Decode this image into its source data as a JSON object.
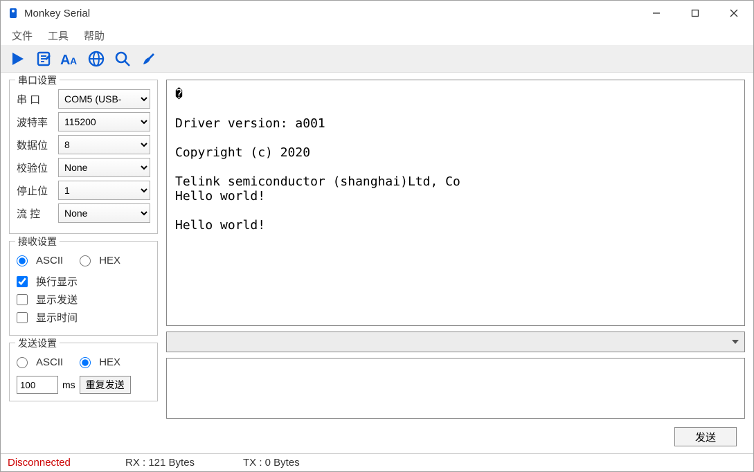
{
  "window": {
    "title": "Monkey Serial"
  },
  "menu": {
    "file": "文件",
    "tools": "工具",
    "help": "帮助"
  },
  "toolbar_icons": {
    "play": "play-icon",
    "notes": "notes-icon",
    "font": "font-icon",
    "globe": "globe-icon",
    "search": "search-icon",
    "brush": "brush-icon"
  },
  "serial_settings": {
    "legend": "串口设置",
    "port": {
      "label": "串   口",
      "value": "COM5 (USB-"
    },
    "baud": {
      "label": "波特率",
      "value": "115200"
    },
    "databits": {
      "label": "数据位",
      "value": "8"
    },
    "parity": {
      "label": "校验位",
      "value": "None"
    },
    "stopbits": {
      "label": "停止位",
      "value": "1"
    },
    "flow": {
      "label": "流   控",
      "value": "None"
    }
  },
  "recv_settings": {
    "legend": "接收设置",
    "ascii": "ASCII",
    "hex": "HEX",
    "wrap": "换行显示",
    "show_send": "显示发送",
    "show_time": "显示时间"
  },
  "send_settings": {
    "legend": "发送设置",
    "ascii": "ASCII",
    "hex": "HEX",
    "interval": "100",
    "ms": "ms",
    "repeat_btn": "重复发送"
  },
  "terminal": "�\n\nDriver version: a001\n\nCopyright (c) 2020\n\nTelink semiconductor (shanghai)Ltd, Co\nHello world!\n\nHello world!",
  "send_button": "发送",
  "status": {
    "conn": "Disconnected",
    "rx": "RX : 121 Bytes",
    "tx": "TX : 0 Bytes"
  }
}
